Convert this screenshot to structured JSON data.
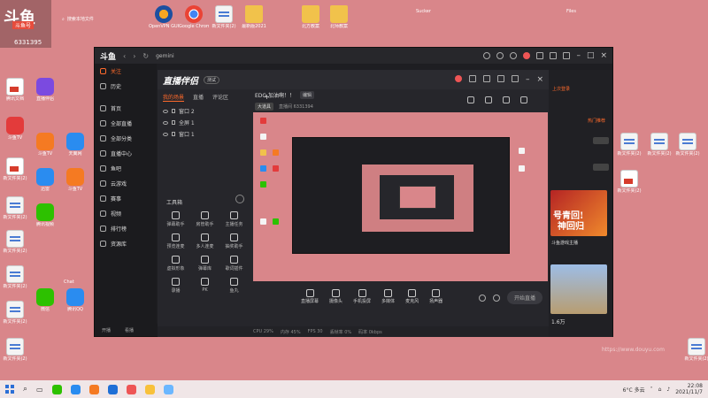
{
  "desktop": {
    "search_hint": "搜索本地文件",
    "top_labels": [
      "Sucker",
      "Files"
    ],
    "overlay_logo": {
      "mark": "斗鱼",
      "sub": "斗鱼号",
      "room": "6331395"
    },
    "icons": [
      {
        "label": "OpenVPN GUI",
        "type": "app-vpn"
      },
      {
        "label": "Google Chrome",
        "type": "app-chrome"
      },
      {
        "label": "新文件夹(2)",
        "type": "doc"
      },
      {
        "label": "最新版2021",
        "type": "folder"
      },
      {
        "label": "北方教案",
        "type": "folder"
      },
      {
        "label": "北师教案",
        "type": "folder"
      },
      {
        "label": "腾讯文档",
        "type": "app-yellow"
      },
      {
        "label": "直播伴侣",
        "type": "app-red"
      },
      {
        "label": "斗鱼TV",
        "type": "app-orange"
      },
      {
        "label": "天翼网",
        "type": "app-blue"
      },
      {
        "label": "迅雷",
        "type": "app-blue"
      },
      {
        "label": "微信",
        "type": "app-green"
      },
      {
        "label": "腾讯QQ",
        "type": "app-blue"
      },
      {
        "label": "腾讯视频",
        "type": "app-purple"
      },
      {
        "label": "Chat",
        "type": "doc"
      }
    ]
  },
  "window": {
    "logo": "斗鱼",
    "title": "gemini",
    "nav": [
      {
        "label": "关注",
        "active": true
      },
      {
        "label": "历史",
        "active": false
      },
      {
        "label": "首页",
        "active": false
      },
      {
        "label": "全部直播",
        "active": false
      },
      {
        "label": "全部分类",
        "active": false
      },
      {
        "label": "直播中心",
        "active": false
      },
      {
        "label": "鱼吧",
        "active": false
      },
      {
        "label": "云游戏",
        "active": false
      },
      {
        "label": "赛事",
        "active": false
      },
      {
        "label": "视频",
        "active": false
      },
      {
        "label": "排行榜",
        "active": false
      },
      {
        "label": "资源库",
        "active": false
      }
    ],
    "footer": {
      "start": "开播",
      "room": "看播"
    }
  },
  "streamer": {
    "brand": "直播伴侣",
    "beta": "测试",
    "tabs": [
      "我的场景",
      "直播",
      "评论区"
    ],
    "scenes": [
      "窗口 2",
      "全屏 1",
      "窗口 1"
    ],
    "tools_title": "工具箱",
    "tools": [
      "弹幕助手",
      "房管助手",
      "主播任务",
      "预览连麦",
      "多人连麦",
      "抽奖助手",
      "虚拟形象",
      "弹幕库",
      "歌词插件",
      "录播",
      "PK",
      "鱼丸"
    ],
    "stream_title": "EDG 加油啊！！",
    "stream_tag": "编辑",
    "category": "大道具",
    "stream_meta": "直播间 6331394",
    "bottom": [
      "直播屏幕",
      "摄像头",
      "手机投屏",
      "多媒体",
      "麦克风",
      "扬声器"
    ],
    "start_btn": "开始直播",
    "footer": [
      "CPU 29%",
      "内存 45%",
      "FPS 30",
      "丢帧率 0%",
      "码率 0kbps"
    ]
  },
  "right_panel": {
    "hot": "上次登录",
    "tag": "热门推荐",
    "card1_text1": "号青回!",
    "card1_text2": "神回归",
    "card1_caption": "斗鱼游戏主播",
    "num": "1.6万"
  },
  "taskbar": {
    "weather": "6°C 多云",
    "time": "22:08",
    "date": "2021/11/7",
    "apps": [
      "#2dc100",
      "#2a8cf0",
      "#f57a22",
      "#1f6fd6",
      "#e55",
      "#f8c13a",
      "#6bb7ff"
    ]
  },
  "watermark": "https://www.douyu.com"
}
